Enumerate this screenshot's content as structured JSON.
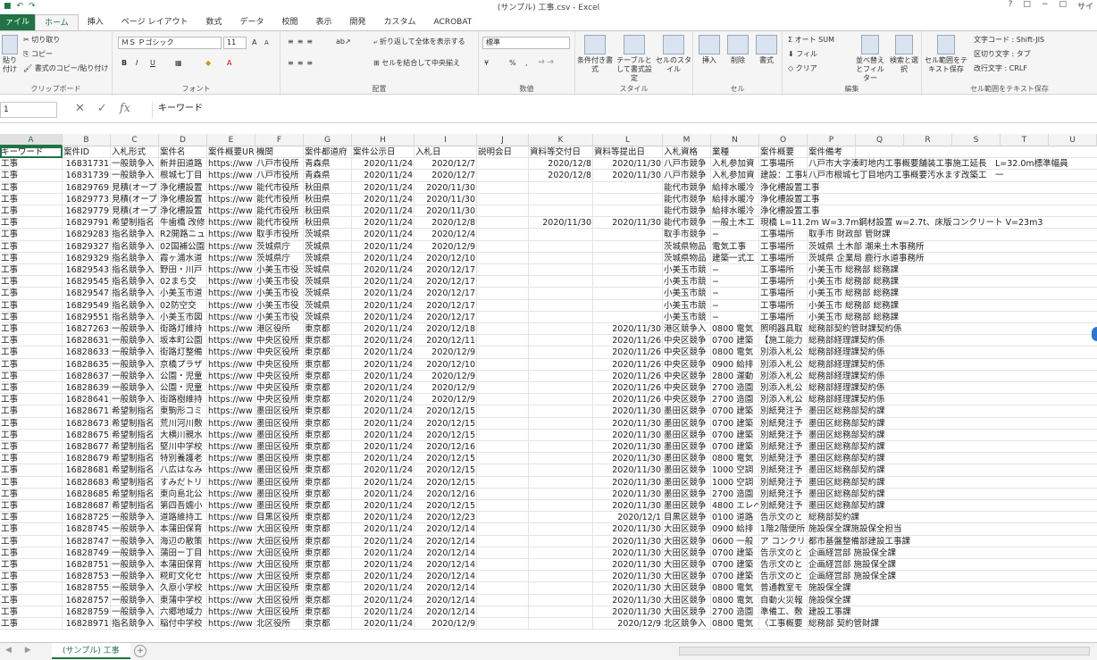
{
  "window": {
    "title": "(サンプル) 工事.csv - Excel",
    "help": "?",
    "controls": [
      "□",
      "−",
      "□"
    ],
    "user": "サイ"
  },
  "tabs": [
    "ァイル",
    "ホーム",
    "挿入",
    "ページ レイアウト",
    "数式",
    "データ",
    "校閲",
    "表示",
    "開発",
    "カスタム",
    "ACROBAT"
  ],
  "ribbon": {
    "clipboard": {
      "cut": "切り取り",
      "copy": "コピー",
      "format_painter": "書式のコピー/貼り付け",
      "paste": "貼り付け",
      "label": "クリップボード"
    },
    "font": {
      "name": "ＭＳ Ｐゴシック",
      "size": "11",
      "grow": "A",
      "shrink": "A",
      "bold": "B",
      "italic": "I",
      "underline": "U",
      "label": "フォント"
    },
    "alignment": {
      "wrap": "折り返して全体を表示する",
      "merge": "セルを結合して中央揃え",
      "label": "配置"
    },
    "number": {
      "format": "標準",
      "percent": "%",
      "comma": ",",
      "label": "数値"
    },
    "styles": {
      "conditional": "条件付き書式",
      "table": "テーブルとして書式設定",
      "cell": "セルのスタイル",
      "label": "スタイル"
    },
    "cells": {
      "insert": "挿入",
      "delete": "削除",
      "format": "書式",
      "label": "セル"
    },
    "editing": {
      "autosum": "オート SUM",
      "fill": "フィル",
      "clear": "クリア",
      "sort": "並べ替えとフィルター",
      "find": "検索と選択",
      "label": "編集"
    },
    "textsave": {
      "button": "セル範囲をテキスト保存",
      "charcode": "文字コード : Shift-JIS",
      "delimiter": "区切り文字 : タブ",
      "newline": "改行文字 : CRLF",
      "label": "セル範囲をテキスト保存"
    }
  },
  "formula_bar": {
    "namebox": "1",
    "value": "キーワード"
  },
  "columns": [
    "A",
    "B",
    "C",
    "D",
    "E",
    "F",
    "G",
    "H",
    "I",
    "J",
    "K",
    "L",
    "M",
    "N",
    "O",
    "P",
    "Q",
    "R",
    "S",
    "T",
    "U"
  ],
  "header_row": [
    "キーワード",
    "案件ID",
    "入札形式",
    "案件名",
    "案件概要URL",
    "機関",
    "案件都道府",
    "案件公示日",
    "入札日",
    "説明会日",
    "資料等交付日",
    "資料等提出日",
    "入札資格",
    "業種",
    "案件概要",
    "案件備考"
  ],
  "rows": [
    [
      "工事",
      "16831731",
      "一般競争入",
      "新井田道路",
      "https://ww",
      "八戸市役所",
      "青森県",
      "2020/11/24",
      "2020/12/7",
      "",
      "2020/12/8",
      "2020/11/30",
      "八戸市競争",
      "入札参加資",
      "工事場所",
      "八戸市大字湊町地内工事概要舗装工事施工延長　L=32.0m標準幅員"
    ],
    [
      "工事",
      "16831739",
      "一般競争入",
      "根城七丁目",
      "https://ww",
      "八戸市役所",
      "青森県",
      "2020/11/24",
      "2020/12/7",
      "",
      "2020/12/8",
      "2020/11/30",
      "八戸市競争",
      "入札参加資",
      "建設：工事場所",
      "八戸市根城七丁目地内工事概要汚水ます改築工　一"
    ],
    [
      "工事",
      "16829769",
      "見積(オープ",
      "浄化槽設置",
      "https://ww",
      "能代市役所",
      "秋田県",
      "2020/11/24",
      "2020/11/30",
      "",
      "",
      "",
      "能代市競争",
      "給排水暖冷",
      "浄化槽設置工事",
      ""
    ],
    [
      "工事",
      "16829773",
      "見積(オープ",
      "浄化槽設置",
      "https://ww",
      "能代市役所",
      "秋田県",
      "2020/11/24",
      "2020/11/30",
      "",
      "",
      "",
      "能代市競争",
      "給排水暖冷",
      "浄化槽設置工事",
      ""
    ],
    [
      "工事",
      "16829779",
      "見積(オープ",
      "浄化槽設置",
      "https://ww",
      "能代市役所",
      "秋田県",
      "2020/11/24",
      "2020/11/30",
      "",
      "",
      "",
      "能代市競争",
      "給排水暖冷",
      "浄化槽設置工事",
      ""
    ],
    [
      "工事",
      "16829791",
      "希望制指名",
      "牛歯橋 改修",
      "https://ww",
      "能代市役所",
      "秋田県",
      "2020/11/24",
      "2020/12/8",
      "",
      "2020/11/30",
      "2020/11/30",
      "能代市競争",
      "一般土木工",
      "現橋 L=11.2m W=3.7m鋼材設置 w=2.7t、床版コンクリート V=23m3",
      ""
    ],
    [
      "工事",
      "16829283",
      "指名競争入",
      "R2開路ニュ",
      "https://ww",
      "取手市役所",
      "茨城県",
      "2020/11/24",
      "2020/12/4",
      "",
      "",
      "",
      "取手市競争",
      "−",
      "工事場所",
      "取手市 財政部 管財課"
    ],
    [
      "工事",
      "16829327",
      "指名競争入",
      "02国補公園",
      "https://ww",
      "茨城県庁",
      "茨城県",
      "2020/11/24",
      "2020/12/9",
      "",
      "",
      "",
      "茨城県物品",
      "電気工事",
      "工事場所",
      "茨城県 土木部 潮来土木事務所"
    ],
    [
      "工事",
      "16829329",
      "指名競争入",
      "霞ヶ浦水道",
      "https://ww",
      "茨城県庁",
      "茨城県",
      "2020/11/24",
      "2020/12/10",
      "",
      "",
      "",
      "茨城県物品",
      "建築一式工",
      "工事場所",
      "茨城県 企業局 鹿行水道事務所"
    ],
    [
      "工事",
      "16829543",
      "指名競争入",
      "野田・川戸",
      "https://ww",
      "小美玉市役",
      "茨城県",
      "2020/11/24",
      "2020/12/17",
      "",
      "",
      "",
      "小美玉市競",
      "−",
      "工事場所",
      "小美玉市 総務部 総務課"
    ],
    [
      "工事",
      "16829545",
      "指名競争入",
      "02まち交",
      "https://ww",
      "小美玉市役",
      "茨城県",
      "2020/11/24",
      "2020/12/17",
      "",
      "",
      "",
      "小美玉市競",
      "−",
      "工事場所",
      "小美玉市 総務部 総務課"
    ],
    [
      "工事",
      "16829547",
      "指名競争入",
      "小美玉市道",
      "https://ww",
      "小美玉市役",
      "茨城県",
      "2020/11/24",
      "2020/12/17",
      "",
      "",
      "",
      "小美玉市競",
      "−",
      "工事場所",
      "小美玉市 総務部 総務課"
    ],
    [
      "工事",
      "16829549",
      "指名競争入",
      "02防空交",
      "https://ww",
      "小美玉市役",
      "茨城県",
      "2020/11/24",
      "2020/12/17",
      "",
      "",
      "",
      "小美玉市競",
      "−",
      "工事場所",
      "小美玉市 総務部 総務課"
    ],
    [
      "工事",
      "16829551",
      "指名競争入",
      "小美玉市図",
      "https://ww",
      "小美玉市役",
      "茨城県",
      "2020/11/24",
      "2020/12/17",
      "",
      "",
      "",
      "小美玉市競",
      "−",
      "工事場所",
      "小美玉市 総務部 総務課"
    ],
    [
      "工事",
      "16827263",
      "一般競争入",
      "街路灯維持",
      "https://ww",
      "港区役所",
      "東京都",
      "2020/11/24",
      "2020/12/18",
      "",
      "",
      "2020/11/30",
      "港区競争入",
      "0800 電気",
      "照明器具取",
      "総務部契約管財課契約係"
    ],
    [
      "工事",
      "16828631",
      "一般競争入",
      "坂本町公園",
      "https://ww",
      "中央区役所",
      "東京都",
      "2020/11/24",
      "2020/12/11",
      "",
      "",
      "2020/11/26",
      "中央区競争",
      "0700 建築",
      "【施工能力",
      "総務部経理課契約係"
    ],
    [
      "工事",
      "16828633",
      "一般競争入",
      "街路灯整備",
      "https://ww",
      "中央区役所",
      "東京都",
      "2020/11/24",
      "2020/12/9",
      "",
      "",
      "2020/11/26",
      "中央区競争",
      "0800 電気",
      "別添入札公",
      "総務部経理課契約係"
    ],
    [
      "工事",
      "16828635",
      "一般競争入",
      "京橋プラザ",
      "https://ww",
      "中央区役所",
      "東京都",
      "2020/11/24",
      "2020/12/10",
      "",
      "",
      "2020/11/26",
      "中央区競争",
      "0900 給排",
      "別添入札公",
      "総務部経理課契約係"
    ],
    [
      "工事",
      "16828637",
      "一般競争入",
      "公園・児童",
      "https://ww",
      "中央区役所",
      "東京都",
      "2020/11/24",
      "2020/12/9",
      "",
      "",
      "2020/11/26",
      "中央区競争",
      "2800 運動",
      "別添入札公",
      "総務部経理課契約係"
    ],
    [
      "工事",
      "16828639",
      "一般競争入",
      "公園・児童",
      "https://ww",
      "中央区役所",
      "東京都",
      "2020/11/24",
      "2020/12/9",
      "",
      "",
      "2020/11/26",
      "中央区競争",
      "2700 造園",
      "別添入札公",
      "総務部経理課契約係"
    ],
    [
      "工事",
      "16828641",
      "一般競争入",
      "街路樹維持",
      "https://ww",
      "中央区役所",
      "東京都",
      "2020/11/24",
      "2020/12/9",
      "",
      "",
      "2020/11/26",
      "中央区競争",
      "2700 造園",
      "別添入札公",
      "総務部経理課契約係"
    ],
    [
      "工事",
      "16828671",
      "希望制指名",
      "東駒形コミ",
      "https://ww",
      "墨田区役所",
      "東京都",
      "2020/11/24",
      "2020/12/15",
      "",
      "",
      "2020/11/30",
      "墨田区競争",
      "0700 建築",
      "別紙発注予",
      "墨田区総務部契約課"
    ],
    [
      "工事",
      "16828673",
      "希望制指名",
      "荒川河川敷",
      "https://ww",
      "墨田区役所",
      "東京都",
      "2020/11/24",
      "2020/12/15",
      "",
      "",
      "2020/11/30",
      "墨田区競争",
      "0700 建築",
      "別紙発注予",
      "墨田区総務部契約課"
    ],
    [
      "工事",
      "16828675",
      "希望制指名",
      "大横川親水",
      "https://ww",
      "墨田区役所",
      "東京都",
      "2020/11/24",
      "2020/12/15",
      "",
      "",
      "2020/11/30",
      "墨田区競争",
      "0700 建築",
      "別紙発注予",
      "墨田区総務部契約課"
    ],
    [
      "工事",
      "16828677",
      "希望制指名",
      "堅川中学校",
      "https://ww",
      "墨田区役所",
      "東京都",
      "2020/11/24",
      "2020/12/16",
      "",
      "",
      "2020/11/30",
      "墨田区競争",
      "0700 建築",
      "別紙発注予",
      "墨田区総務部契約課"
    ],
    [
      "工事",
      "16828679",
      "希望制指名",
      "特別養護老",
      "https://ww",
      "墨田区役所",
      "東京都",
      "2020/11/24",
      "2020/12/15",
      "",
      "",
      "2020/11/30",
      "墨田区競争",
      "0800 電気",
      "別紙発注予",
      "墨田区総務部契約課"
    ],
    [
      "工事",
      "16828681",
      "希望制指名",
      "八広はなみ",
      "https://ww",
      "墨田区役所",
      "東京都",
      "2020/11/24",
      "2020/12/15",
      "",
      "",
      "2020/11/30",
      "墨田区競争",
      "1000 空調",
      "別紙発注予",
      "墨田区総務部契約課"
    ],
    [
      "工事",
      "16828683",
      "希望制指名",
      "すみだトリ",
      "https://ww",
      "墨田区役所",
      "東京都",
      "2020/11/24",
      "2020/12/15",
      "",
      "",
      "2020/11/30",
      "墨田区競争",
      "1000 空調",
      "別紙発注予",
      "墨田区総務部契約課"
    ],
    [
      "工事",
      "16828685",
      "希望制指名",
      "東向島北公",
      "https://ww",
      "墨田区役所",
      "東京都",
      "2020/11/24",
      "2020/12/16",
      "",
      "",
      "2020/11/30",
      "墨田区競争",
      "2700 造園",
      "別紙発注予",
      "墨田区総務部契約課"
    ],
    [
      "工事",
      "16828687",
      "希望制指名",
      "第四吾嬬小",
      "https://ww",
      "墨田区役所",
      "東京都",
      "2020/11/24",
      "2020/12/15",
      "",
      "",
      "2020/11/30",
      "墨田区競争",
      "4800 エレベ",
      "別紙発注予",
      "墨田区総務部契約課"
    ],
    [
      "工事",
      "16828725",
      "一般競争入",
      "道路維持工",
      "https://ww",
      "目黒区役所",
      "東京都",
      "2020/11/24",
      "2020/12/23",
      "",
      "",
      "2020/12/1",
      "目黒区競争",
      "0100 道路",
      "告示文のと",
      "総務部契約課"
    ],
    [
      "工事",
      "16828745",
      "一般競争入",
      "本蒲田保育",
      "https://ww",
      "大田区役所",
      "東京都",
      "2020/11/24",
      "2020/12/14",
      "",
      "",
      "2020/11/30",
      "大田区競争",
      "0900 給排",
      "1階2階便所",
      "施設保全課施設保全担当"
    ],
    [
      "工事",
      "16828747",
      "一般競争入",
      "海辺の散策",
      "https://ww",
      "大田区役所",
      "東京都",
      "2020/11/24",
      "2020/12/14",
      "",
      "",
      "2020/11/30",
      "大田区競争",
      "0600 一般",
      "ア コンクリ",
      "都市基盤整備部建設工事課"
    ],
    [
      "工事",
      "16828749",
      "一般競争入",
      "蒲田ー丁目",
      "https://ww",
      "大田区役所",
      "東京都",
      "2020/11/24",
      "2020/12/14",
      "",
      "",
      "2020/11/30",
      "大田区競争",
      "0700 建築",
      "告示文のと",
      "企画経営部 施設保全課"
    ],
    [
      "工事",
      "16828751",
      "一般競争入",
      "本蒲田保育",
      "https://ww",
      "大田区役所",
      "東京都",
      "2020/11/24",
      "2020/12/14",
      "",
      "",
      "2020/11/30",
      "大田区競争",
      "0700 建築",
      "告示文のと",
      "企画経営部 施設保全課"
    ],
    [
      "工事",
      "16828753",
      "一般競争入",
      "糀町文化セ",
      "https://ww",
      "大田区役所",
      "東京都",
      "2020/11/24",
      "2020/12/14",
      "",
      "",
      "2020/11/30",
      "大田区競争",
      "0700 建築",
      "告示文のと",
      "企画経営部 施設保全課"
    ],
    [
      "工事",
      "16828755",
      "一般競争入",
      "久原小学校",
      "https://ww",
      "大田区役所",
      "東京都",
      "2020/11/24",
      "2020/12/14",
      "",
      "",
      "2020/11/30",
      "大田区競争",
      "0800 電気",
      "普通教室モ",
      "施設保全課"
    ],
    [
      "工事",
      "16828757",
      "一般競争入",
      "東蒲中学校",
      "https://ww",
      "大田区役所",
      "東京都",
      "2020/11/24",
      "2020/12/14",
      "",
      "",
      "2020/11/30",
      "大田区競争",
      "0800 電気",
      "自動火災報",
      "施設保全課"
    ],
    [
      "工事",
      "16828759",
      "一般競争入",
      "六郷地域力",
      "https://ww",
      "大田区役所",
      "東京都",
      "2020/11/24",
      "2020/12/14",
      "",
      "",
      "2020/11/30",
      "大田区競争",
      "2700 造園",
      "準備工、敷",
      "建設工事課"
    ],
    [
      "工事",
      "16828971",
      "指名競争入",
      "稲付中学校",
      "https://ww",
      "北区役所",
      "東京都",
      "2020/11/24",
      "2020/12/9",
      "",
      "",
      "2020/12/9",
      "北区競争入",
      "0800 電気",
      "〈工事概要",
      "総務部 契約管財課"
    ]
  ],
  "sheet": {
    "name": "(サンプル) 工事",
    "add": "+",
    "nav": "◀ ▶"
  }
}
